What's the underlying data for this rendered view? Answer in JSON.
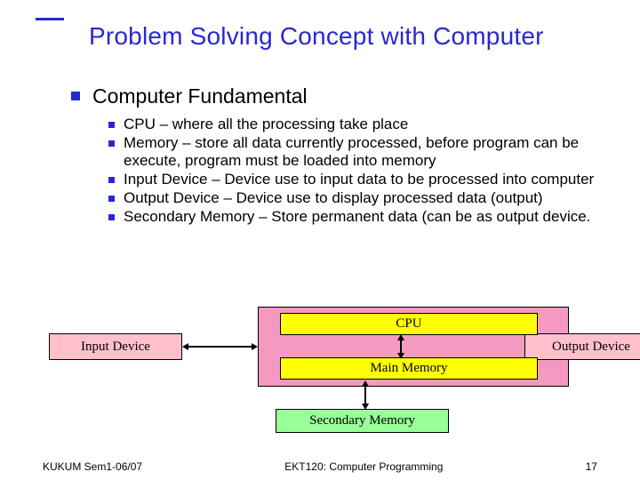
{
  "title": "Problem Solving Concept with Computer",
  "heading": "Computer Fundamental",
  "items": [
    "CPU – where all the processing take place",
    "Memory – store all data currently processed, before program can be execute, program must be loaded into memory",
    "Input Device – Device use to input data to be processed into computer",
    "Output Device – Device use to display processed data (output)",
    "Secondary Memory – Store permanent data (can be as output device."
  ],
  "diagram": {
    "cpu": "CPU",
    "main_memory": "Main Memory",
    "input": "Input Device",
    "output": "Output Device",
    "secondary": "Secondary Memory"
  },
  "footer": {
    "left": "KUKUM Sem1-06/07",
    "center": "EKT120: Computer Programming",
    "right": "17"
  }
}
